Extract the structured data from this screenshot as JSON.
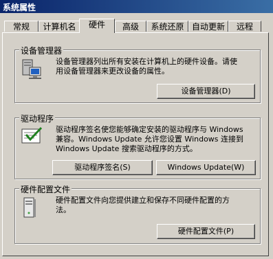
{
  "window": {
    "title": "系统属性"
  },
  "tabs": [
    {
      "label": "常规"
    },
    {
      "label": "计算机名"
    },
    {
      "label": "硬件"
    },
    {
      "label": "高级"
    },
    {
      "label": "系统还原"
    },
    {
      "label": "自动更新"
    },
    {
      "label": "远程"
    }
  ],
  "active_tab": "硬件",
  "device_manager": {
    "title": "设备管理器",
    "desc_line1": "设备管理器列出所有安装在计算机上的硬件设备。请使",
    "desc_line2": "用设备管理器来更改设备的属性。",
    "button": "设备管理器(D)",
    "icon": "device-manager-icon"
  },
  "drivers": {
    "title": "驱动程序",
    "desc_line1": "驱动程序签名使您能够确定安装的驱动程序与 Windows",
    "desc_line2": "兼容。Windows Update 允许您设置 Windows 连接到",
    "desc_line3": "Windows Update 搜索驱动程序的方式。",
    "signing_button": "驱动程序签名(S)",
    "update_button": "Windows Update(W)",
    "icon": "driver-signing-icon"
  },
  "hardware_profiles": {
    "title": "硬件配置文件",
    "desc_line1": "硬件配置文件向您提供建立和保存不同硬件配置的方",
    "desc_line2": "法。",
    "button": "硬件配置文件(P)",
    "icon": "computer-tower-icon"
  }
}
